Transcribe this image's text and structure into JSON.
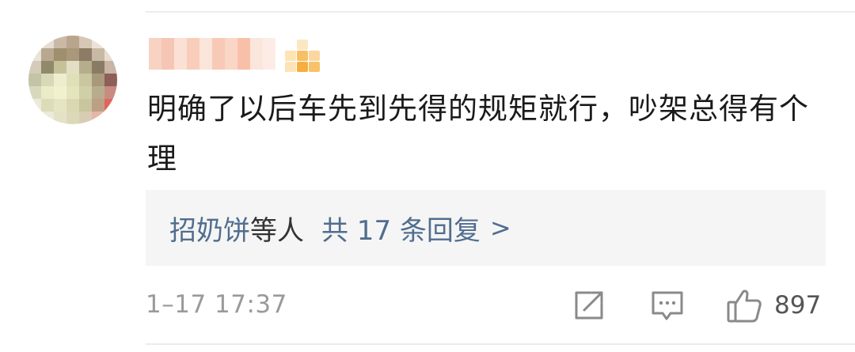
{
  "comment": {
    "text": "明确了以后车先到先得的规矩就行，吵架总得有个理",
    "timestamp": "1–17 17:37"
  },
  "replies": {
    "name": "招奶饼",
    "mid": "等人",
    "count_label": "共 17 条回复",
    "arrow": ">"
  },
  "actions": {
    "share_icon": "share-icon",
    "comment_icon": "comment-icon",
    "like_icon": "thumbs-up-icon",
    "like_count": "897"
  },
  "colors": {
    "link": "#506d8f",
    "text": "#1a1a1a",
    "muted": "#9a9a9a",
    "reply_bg": "#f5f5f5"
  }
}
